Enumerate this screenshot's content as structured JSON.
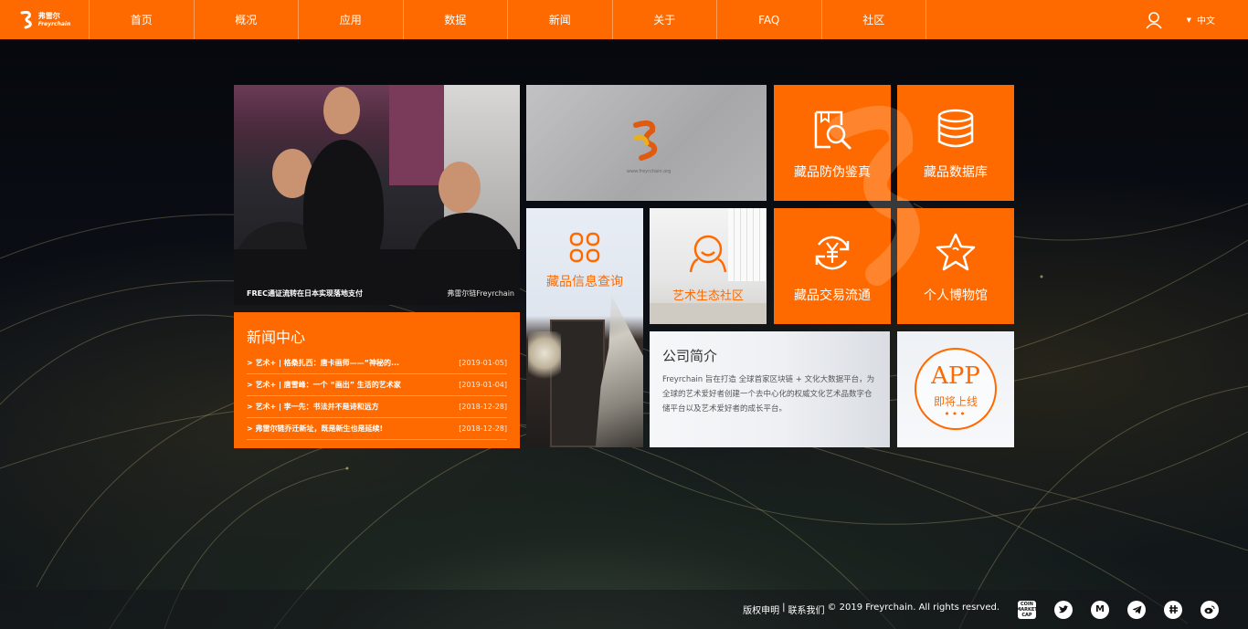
{
  "brand": {
    "logo_cn": "弗雷尔",
    "logo_en": "Freyrchain",
    "accent": "#ff6a00"
  },
  "nav": {
    "items": [
      "首页",
      "概况",
      "应用",
      "数据",
      "新闻",
      "关于",
      "FAQ",
      "社区"
    ],
    "language": "中文"
  },
  "photo": {
    "caption": "FREC通证流转在日本实现落地支付",
    "watermark": "弗雷尔链Freyrchain"
  },
  "news": {
    "title": "新闻中心",
    "items": [
      {
        "title": "> 艺术+ | 格桑扎西：唐卡画师——“神秘的...",
        "date": "[2019-01-05]"
      },
      {
        "title": "> 艺术+ | 唐雪峰：一个 “画出” 生活的艺术家",
        "date": "[2019-01-04]"
      },
      {
        "title": "> 艺术+ | 李一先：书法并不是诗和远方",
        "date": "[2018-12-28]"
      },
      {
        "title": "> 弗雷尔链乔迁新址，既是新生也是延续!",
        "date": "[2018-12-28]"
      }
    ]
  },
  "video": {
    "site": "www.freyrchain.org"
  },
  "tiles": {
    "anti_fake": "藏品防伪鉴真",
    "database": "藏品数据库",
    "info_query": "藏品信息查询",
    "art_community": "艺术生态社区",
    "trade": "藏品交易流通",
    "museum": "个人博物馆"
  },
  "intro": {
    "title": "公司简介",
    "text": "Freyrchain 旨在打造 全球首家区块链 + 文化大数据平台，为全球的艺术爱好者创建一个去中心化的权威文化艺术品数字仓储平台以及艺术爱好者的成长平台。"
  },
  "app": {
    "big": "APP",
    "small": "即将上线",
    "dots": "•••"
  },
  "footer": {
    "copyright_link": "版权申明",
    "separator": "|",
    "contact_link": "联系我们",
    "copyright": "© 2019 Freyrchain. All rights resrved.",
    "social": [
      "coinmarketcap-icon",
      "twitter-icon",
      "medium-icon",
      "telegram-icon",
      "slack-icon",
      "weibo-icon"
    ],
    "coin_label": "COIN MARKET CAP",
    "medium_label": "M"
  }
}
